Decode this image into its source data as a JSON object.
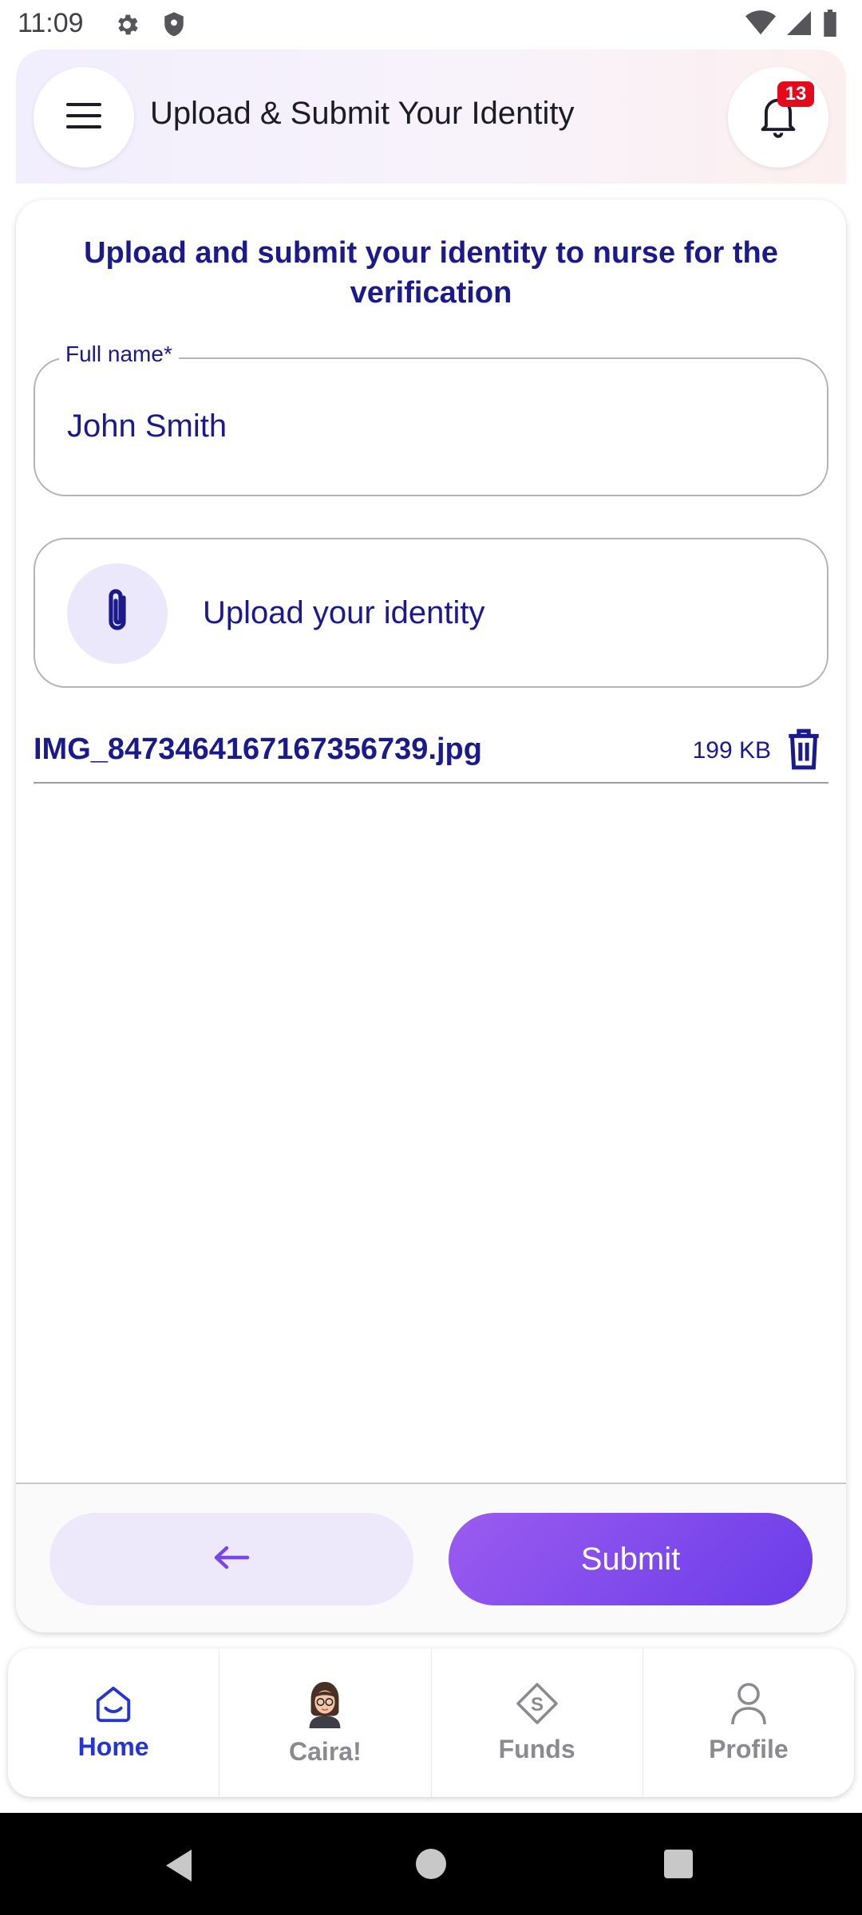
{
  "status_bar": {
    "time": "11:09"
  },
  "header": {
    "title": "Upload & Submit Your Identity",
    "notification_count": "13"
  },
  "form": {
    "heading": "Upload and submit your identity to nurse for the verification",
    "full_name_label": "Full name*",
    "full_name_value": "John Smith",
    "upload_label": "Upload your identity"
  },
  "file": {
    "name": "IMG_8473464167167356739.jpg",
    "size": "199 KB"
  },
  "actions": {
    "submit_label": "Submit"
  },
  "bottom_nav": {
    "items": [
      {
        "label": "Home",
        "icon": "home-icon",
        "active": true
      },
      {
        "label": "Caira!",
        "icon": "caira-avatar",
        "active": false
      },
      {
        "label": "Funds",
        "icon": "funds-icon",
        "active": false
      },
      {
        "label": "Profile",
        "icon": "profile-icon",
        "active": false
      }
    ]
  },
  "colors": {
    "primary_text": "#1a1a8c",
    "accent": "#7b45ec",
    "badge": "#e5091c",
    "nav_active": "#2434d6"
  }
}
